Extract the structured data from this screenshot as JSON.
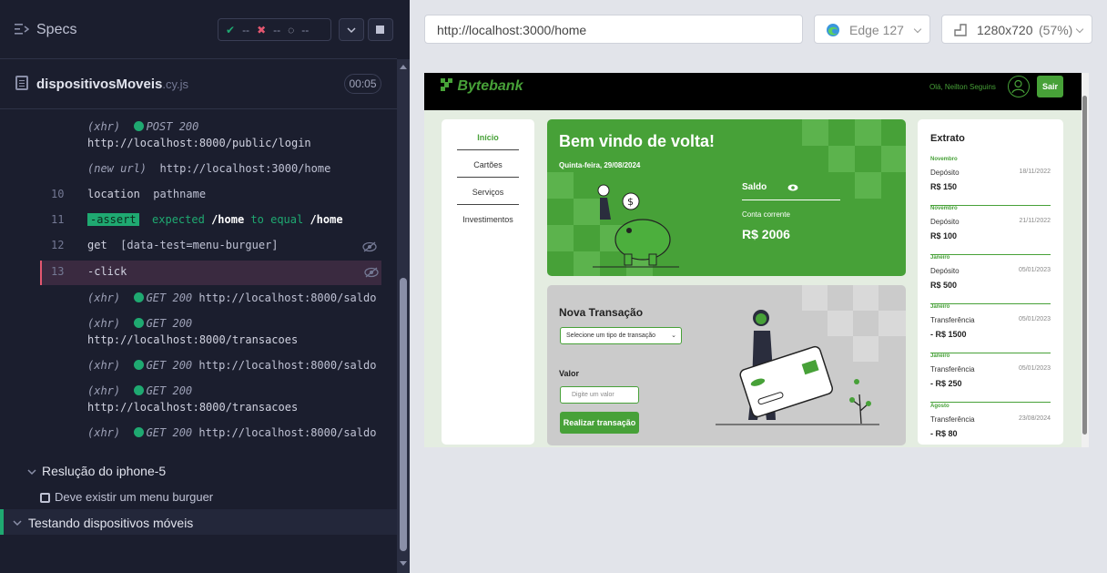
{
  "runner": {
    "specs_title": "Specs",
    "stats": {
      "passed": "--",
      "failed": "--",
      "pending": "--"
    },
    "spec_file": {
      "name": "dispositivosMoveis",
      "ext": ".cy.js",
      "time": "00:05"
    }
  },
  "command_log": [
    {
      "num": "",
      "prefix": "(xhr)",
      "method": "POST 200",
      "url": "http://localhost:8000/public/login"
    },
    {
      "num": "",
      "prefix": "(new url)",
      "url": "http://localhost:3000/home"
    },
    {
      "num": "10",
      "name": "location",
      "arg": "pathname"
    },
    {
      "num": "11",
      "name": "-assert",
      "expected": "expected",
      "path1": "/home",
      "to_equal": "to equal",
      "path2": "/home"
    },
    {
      "num": "12",
      "name": "get",
      "arg": "[data-test=menu-burguer]"
    },
    {
      "num": "13",
      "name": "-click"
    },
    {
      "prefix": "(xhr)",
      "method": "GET 200",
      "url": "http://localhost:8000/saldo"
    },
    {
      "prefix": "(xhr)",
      "method": "GET 200",
      "url": "http://localhost:8000/transacoes"
    },
    {
      "prefix": "(xhr)",
      "method": "GET 200",
      "url": "http://localhost:8000/saldo"
    },
    {
      "prefix": "(xhr)",
      "method": "GET 200",
      "url": "http://localhost:8000/transacoes"
    },
    {
      "prefix": "(xhr)",
      "method": "GET 200",
      "url": "http://localhost:8000/saldo"
    }
  ],
  "suites": {
    "suite1": "Reslução do iphone-5",
    "test1": "Deve existir um menu burguer",
    "suite2": "Testando dispositivos móveis"
  },
  "aut": {
    "url": "http://localhost:3000/home",
    "browser": "Edge 127",
    "viewport": "1280x720",
    "scale": "(57%)"
  },
  "app": {
    "logo": "Bytebank",
    "greeting": "Olá, Neilton Seguins",
    "logout": "Sair",
    "nav": [
      "Início",
      "Cartões",
      "Serviços",
      "Investimentos"
    ],
    "welcome": {
      "title": "Bem vindo de volta!",
      "date": "Quinta-feira, 29/08/2024",
      "saldo_label": "Saldo",
      "account": "Conta corrente",
      "balance": "R$ 2006"
    },
    "transaction": {
      "title": "Nova Transação",
      "select_placeholder": "Selecione um tipo de transação",
      "valor_label": "Valor",
      "valor_placeholder": "Digite um valor",
      "submit": "Realizar transação"
    },
    "statement": {
      "title": "Extrato",
      "entries": [
        {
          "month": "Novembro",
          "type": "Depósito",
          "date": "18/11/2022",
          "value": "R$ 150"
        },
        {
          "month": "Novembro",
          "type": "Depósito",
          "date": "21/11/2022",
          "value": "R$ 100"
        },
        {
          "month": "Janeiro",
          "type": "Depósito",
          "date": "05/01/2023",
          "value": "R$ 500"
        },
        {
          "month": "Janeiro",
          "type": "Transferência",
          "date": "05/01/2023",
          "value": "- R$ 1500"
        },
        {
          "month": "Janeiro",
          "type": "Transferência",
          "date": "05/01/2023",
          "value": "- R$ 250"
        },
        {
          "month": "Agosto",
          "type": "Transferência",
          "date": "23/08/2024",
          "value": "- R$ 80"
        }
      ]
    }
  },
  "colors": {
    "accent": "#47a138",
    "pass": "#1fa971",
    "fail": "#e45770",
    "runner_bg": "#1b1e2e"
  }
}
